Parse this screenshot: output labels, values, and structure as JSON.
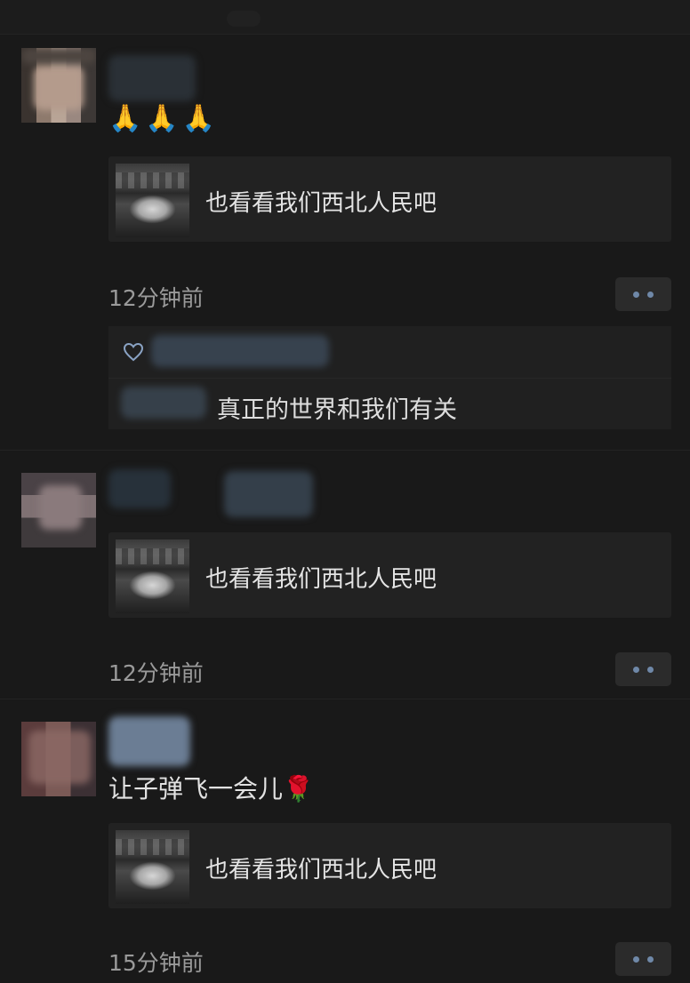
{
  "posts": [
    {
      "emoji": "🙏🙏🙏",
      "link_title": "也看看我们西北人民吧",
      "time": "12分钟前",
      "comment_text": "真正的世界和我们有关"
    },
    {
      "link_title": "也看看我们西北人民吧",
      "time": "12分钟前"
    },
    {
      "text": "让子弹飞一会儿🌹",
      "link_title": "也看看我们西北人民吧",
      "time": "15分钟前"
    }
  ],
  "colors": {
    "background": "#191919",
    "card": "#222222",
    "more_dot": "#6f88a8"
  }
}
